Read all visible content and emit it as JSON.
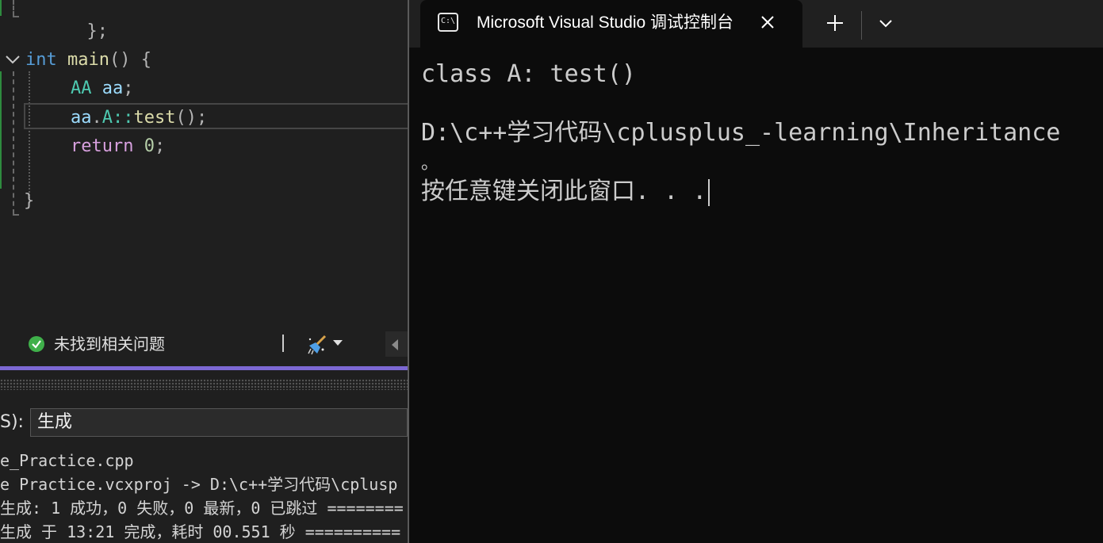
{
  "editor": {
    "line_top_fragment": "};",
    "line_main": {
      "kw_int": "int",
      "fn_main": "main",
      "parens": "()",
      "brace_open": "{"
    },
    "line_decl": {
      "type": "AA",
      "var": "aa",
      "semi": ";"
    },
    "line_call": {
      "var": "aa",
      "dot": ".",
      "scope": "A::",
      "fn": "test",
      "rest": "();"
    },
    "line_return": {
      "kw": "return",
      "num": "0",
      "semi": ";"
    },
    "line_close": "}"
  },
  "statusbar": {
    "issues_text": "未找到相关问题"
  },
  "output": {
    "source_label": "S):",
    "source_value": "生成",
    "lines": [
      "e_Practice.cpp",
      "e Practice.vcxproj -> D:\\c++学习代码\\cplusp",
      "生成: 1 成功，0 失败，0 最新，0 已跳过 ========",
      "生成 于 13:21 完成，耗时 00.551 秒 =========="
    ]
  },
  "terminal": {
    "tab_title": "Microsoft Visual Studio 调试控制台",
    "icon_text": "C:\\",
    "lines": [
      "class A: test()",
      "D:\\c++学习代码\\cplusplus_-learning\\Inheritance",
      "。",
      "按任意键关闭此窗口. . ."
    ]
  }
}
